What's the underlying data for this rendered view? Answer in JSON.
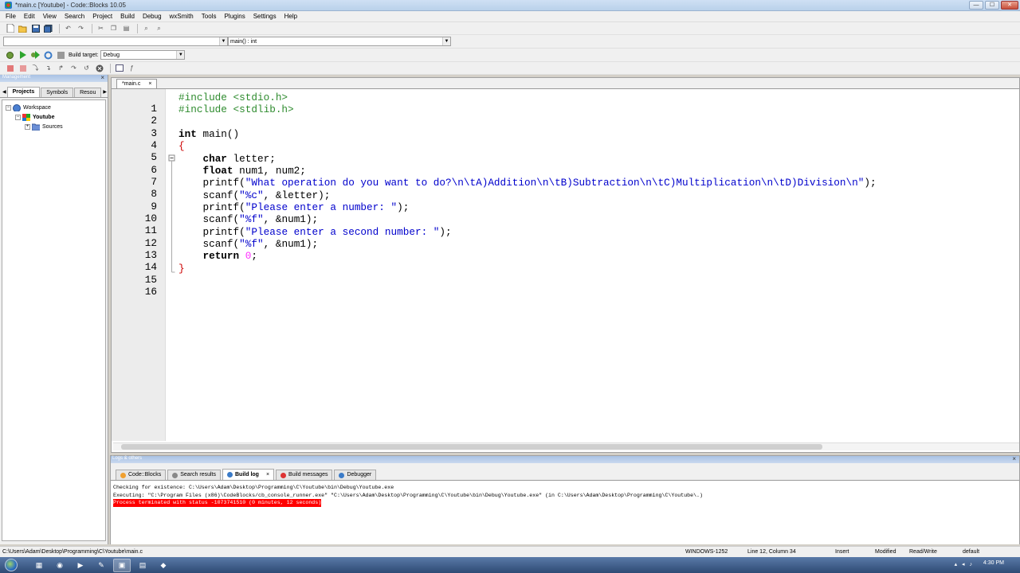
{
  "window": {
    "title": "*main.c [Youtube] - Code::Blocks 10.05"
  },
  "window_buttons": {
    "minimize": "—",
    "maximize": "☐",
    "close": "✕"
  },
  "menu": [
    "File",
    "Edit",
    "View",
    "Search",
    "Project",
    "Build",
    "Debug",
    "wxSmith",
    "Tools",
    "Plugins",
    "Settings",
    "Help"
  ],
  "toolbar": {
    "scope_value": "",
    "function_value": "main() : int",
    "build_target_label": "Build target:",
    "build_target_value": "Debug"
  },
  "management": {
    "title": "Management",
    "tabs": [
      "Projects",
      "Symbols",
      "Resou"
    ],
    "tree": {
      "workspace": "Workspace",
      "project": "Youtube",
      "folder": "Sources"
    }
  },
  "editor": {
    "tab_label": "*main.c",
    "tab_close": "×",
    "line_numbers": [
      "1",
      "2",
      "3",
      "4",
      "5",
      "6",
      "7",
      "8",
      "9",
      "10",
      "11",
      "12",
      "13",
      "14",
      "15",
      "16"
    ],
    "code": {
      "l1": "#include <stdio.h>",
      "l2": "#include <stdlib.h>",
      "l4_kw": "int",
      "l4_rest": " main()",
      "l5": "{",
      "l6_kw": "char",
      "l6_rest": " letter;",
      "l7_kw": "float",
      "l7_rest": " num1, num2;",
      "l8_pre": "printf(",
      "l8_str": "\"What operation do you want to do?\\n\\tA)Addition\\n\\tB)Subtraction\\n\\tC)Multiplication\\n\\tD)Division\\n\"",
      "l8_post": ");",
      "l9_pre": "scanf(",
      "l9_str": "\"%c\"",
      "l9_post": ", &letter);",
      "l10_pre": "printf(",
      "l10_str": "\"Please enter a number: \"",
      "l10_post": ");",
      "l11_pre": "scanf(",
      "l11_str": "\"%f\"",
      "l11_post": ", &num1);",
      "l12_pre": "printf(",
      "l12_str": "\"Please enter a second number: \"",
      "l12_post": ");",
      "l13_pre": "scanf(",
      "l13_str": "\"%f\"",
      "l13_post": ", &num1);",
      "l14_kw": "return",
      "l14_num": " 0",
      "l14_post": ";",
      "l15": "}"
    }
  },
  "logs": {
    "title": "Logs & others",
    "tabs": [
      "Code::Blocks",
      "Search results",
      "Build log",
      "Build messages",
      "Debugger"
    ],
    "active_tab": "Build log",
    "lines": [
      "Checking for existence: C:\\Users\\Adam\\Desktop\\Programming\\C\\Youtube\\bin\\Debug\\Youtube.exe",
      "Executing: \"C:\\Program Files (x86)\\CodeBlocks/cb_console_runner.exe\" \"C:\\Users\\Adam\\Desktop\\Programming\\C\\Youtube\\bin\\Debug\\Youtube.exe\"  (in C:\\Users\\Adam\\Desktop\\Programming\\C\\Youtube\\.)"
    ],
    "error_line": "Process terminated with status -1073741510 (0 minutes, 12 seconds)"
  },
  "status": {
    "path": "C:\\Users\\Adam\\Desktop\\Programming\\C\\Youtube\\main.c",
    "encoding": "WINDOWS-1252",
    "position": "Line 12, Column 34",
    "mode": "Insert",
    "modified": "Modified",
    "access": "Read/Write",
    "profile": "default"
  },
  "taskbar": {
    "clock": "4:30 PM"
  },
  "colors": {
    "preprocessor": "#2e8b2e",
    "string": "#0000cc",
    "number": "#ff2fff",
    "error_bg": "#ff0000"
  }
}
